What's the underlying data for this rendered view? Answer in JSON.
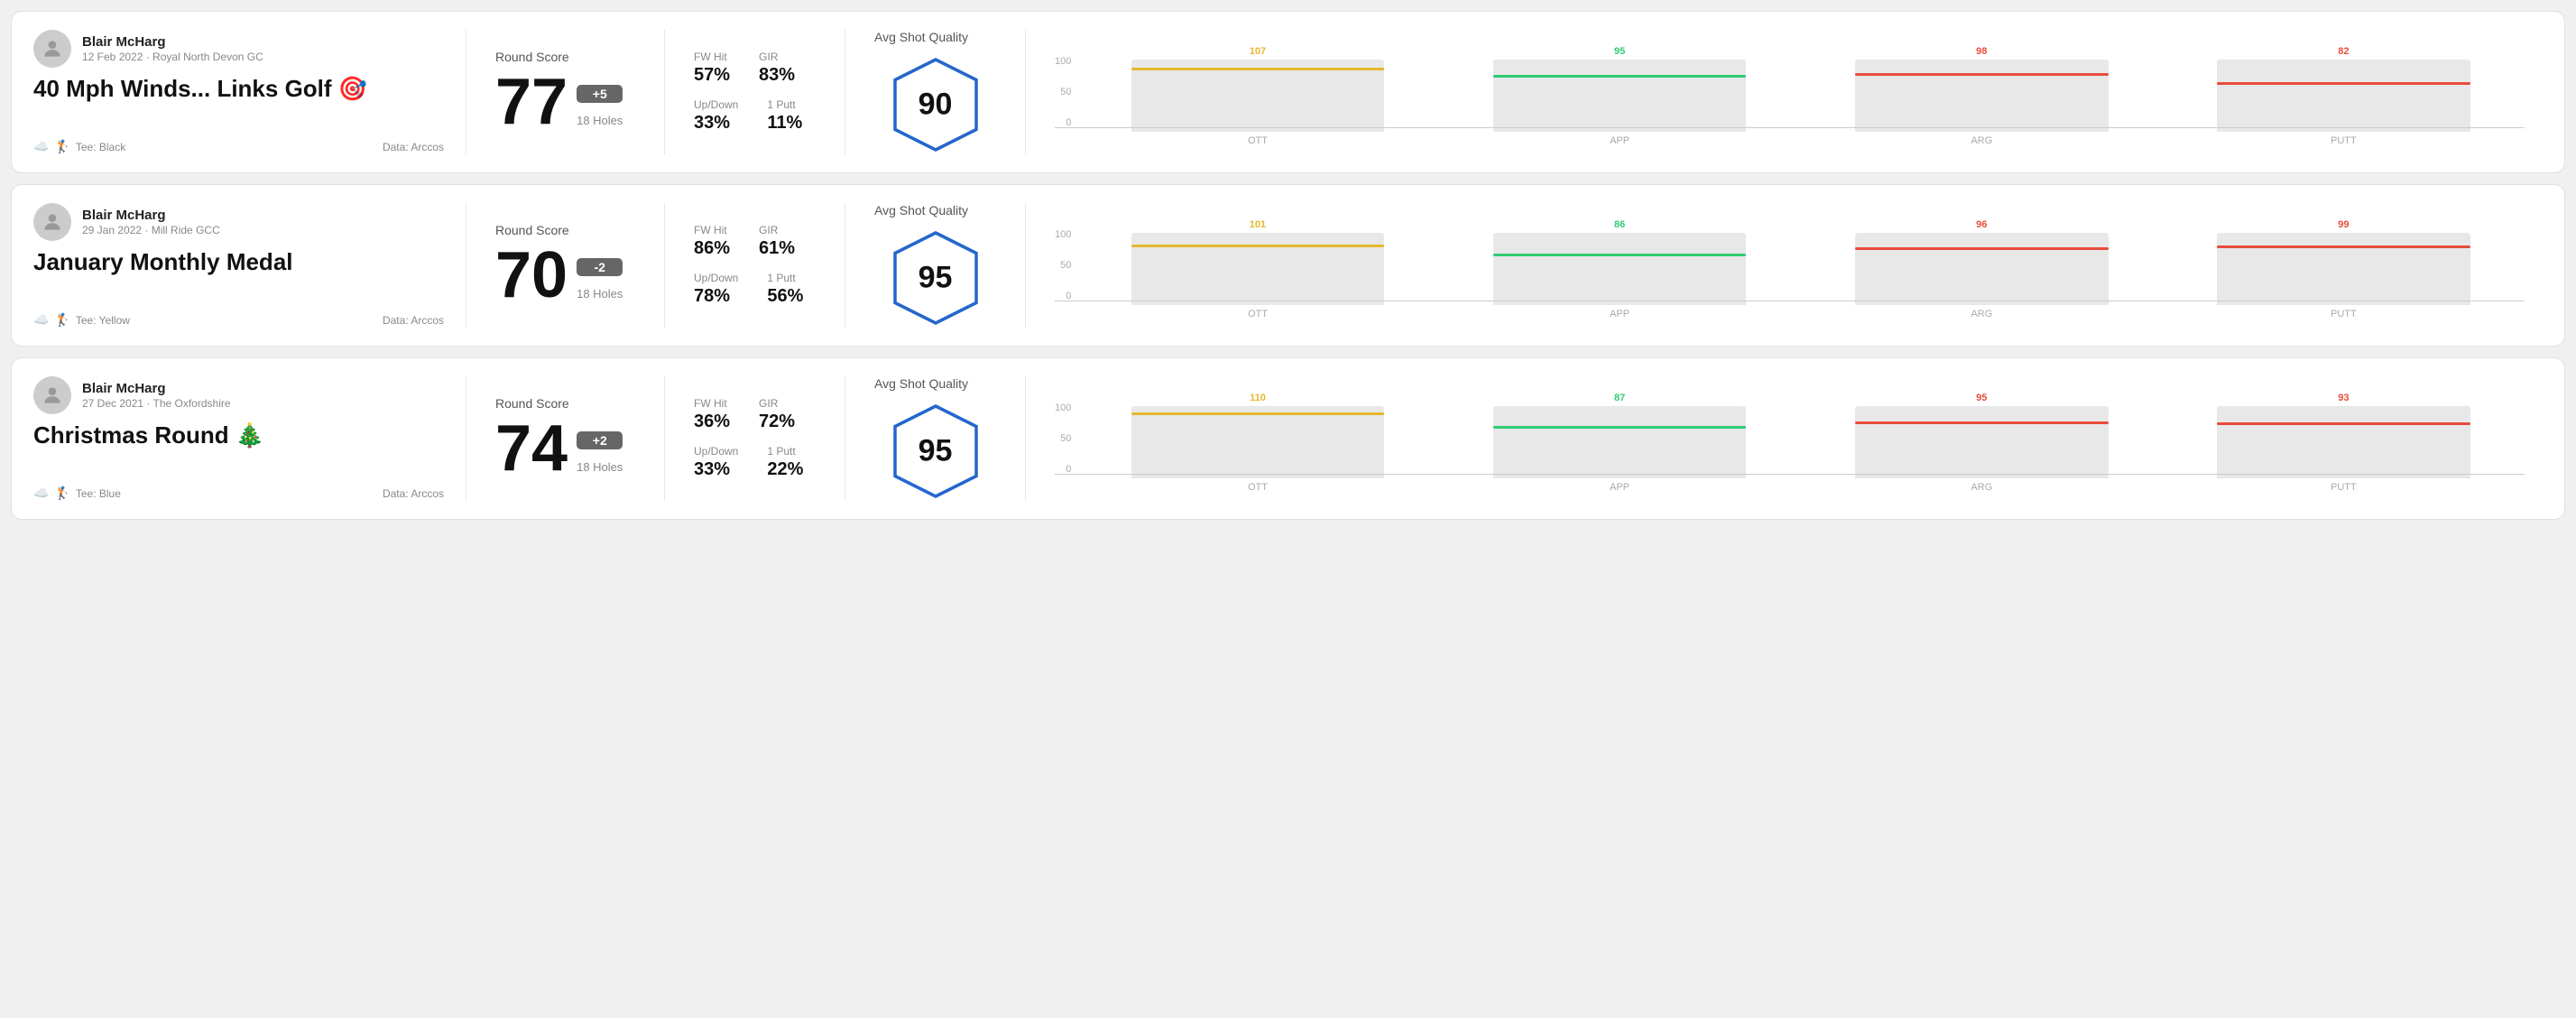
{
  "rounds": [
    {
      "id": "round1",
      "user": {
        "name": "Blair McHarg",
        "date": "12 Feb 2022 · Royal North Devon GC"
      },
      "title": "40 Mph Winds... Links Golf 🎯",
      "tee": "Black",
      "data_source": "Data: Arccos",
      "score": {
        "label": "Round Score",
        "number": "77",
        "badge": "+5",
        "badge_type": "positive",
        "holes": "18 Holes"
      },
      "stats": {
        "fw_hit_label": "FW Hit",
        "fw_hit_value": "57%",
        "gir_label": "GIR",
        "gir_value": "83%",
        "updown_label": "Up/Down",
        "updown_value": "33%",
        "oneputt_label": "1 Putt",
        "oneputt_value": "11%"
      },
      "quality": {
        "label": "Avg Shot Quality",
        "score": "90"
      },
      "chart": {
        "bars": [
          {
            "label": "OTT",
            "value": 107,
            "max": 120,
            "color": "#e6b830"
          },
          {
            "label": "APP",
            "value": 95,
            "max": 120,
            "color": "#2ecc71"
          },
          {
            "label": "ARG",
            "value": 98,
            "max": 120,
            "color": "#e74c3c"
          },
          {
            "label": "PUTT",
            "value": 82,
            "max": 120,
            "color": "#e74c3c"
          }
        ]
      }
    },
    {
      "id": "round2",
      "user": {
        "name": "Blair McHarg",
        "date": "29 Jan 2022 · Mill Ride GCC"
      },
      "title": "January Monthly Medal",
      "tee": "Yellow",
      "data_source": "Data: Arccos",
      "score": {
        "label": "Round Score",
        "number": "70",
        "badge": "-2",
        "badge_type": "negative",
        "holes": "18 Holes"
      },
      "stats": {
        "fw_hit_label": "FW Hit",
        "fw_hit_value": "86%",
        "gir_label": "GIR",
        "gir_value": "61%",
        "updown_label": "Up/Down",
        "updown_value": "78%",
        "oneputt_label": "1 Putt",
        "oneputt_value": "56%"
      },
      "quality": {
        "label": "Avg Shot Quality",
        "score": "95"
      },
      "chart": {
        "bars": [
          {
            "label": "OTT",
            "value": 101,
            "max": 120,
            "color": "#e6b830"
          },
          {
            "label": "APP",
            "value": 86,
            "max": 120,
            "color": "#2ecc71"
          },
          {
            "label": "ARG",
            "value": 96,
            "max": 120,
            "color": "#e74c3c"
          },
          {
            "label": "PUTT",
            "value": 99,
            "max": 120,
            "color": "#e74c3c"
          }
        ]
      }
    },
    {
      "id": "round3",
      "user": {
        "name": "Blair McHarg",
        "date": "27 Dec 2021 · The Oxfordshire"
      },
      "title": "Christmas Round 🎄",
      "tee": "Blue",
      "data_source": "Data: Arccos",
      "score": {
        "label": "Round Score",
        "number": "74",
        "badge": "+2",
        "badge_type": "positive",
        "holes": "18 Holes"
      },
      "stats": {
        "fw_hit_label": "FW Hit",
        "fw_hit_value": "36%",
        "gir_label": "GIR",
        "gir_value": "72%",
        "updown_label": "Up/Down",
        "updown_value": "33%",
        "oneputt_label": "1 Putt",
        "oneputt_value": "22%"
      },
      "quality": {
        "label": "Avg Shot Quality",
        "score": "95"
      },
      "chart": {
        "bars": [
          {
            "label": "OTT",
            "value": 110,
            "max": 120,
            "color": "#e6b830"
          },
          {
            "label": "APP",
            "value": 87,
            "max": 120,
            "color": "#2ecc71"
          },
          {
            "label": "ARG",
            "value": 95,
            "max": 120,
            "color": "#e74c3c"
          },
          {
            "label": "PUTT",
            "value": 93,
            "max": 120,
            "color": "#e74c3c"
          }
        ]
      }
    }
  ],
  "y_axis_labels": [
    "100",
    "50",
    "0"
  ]
}
